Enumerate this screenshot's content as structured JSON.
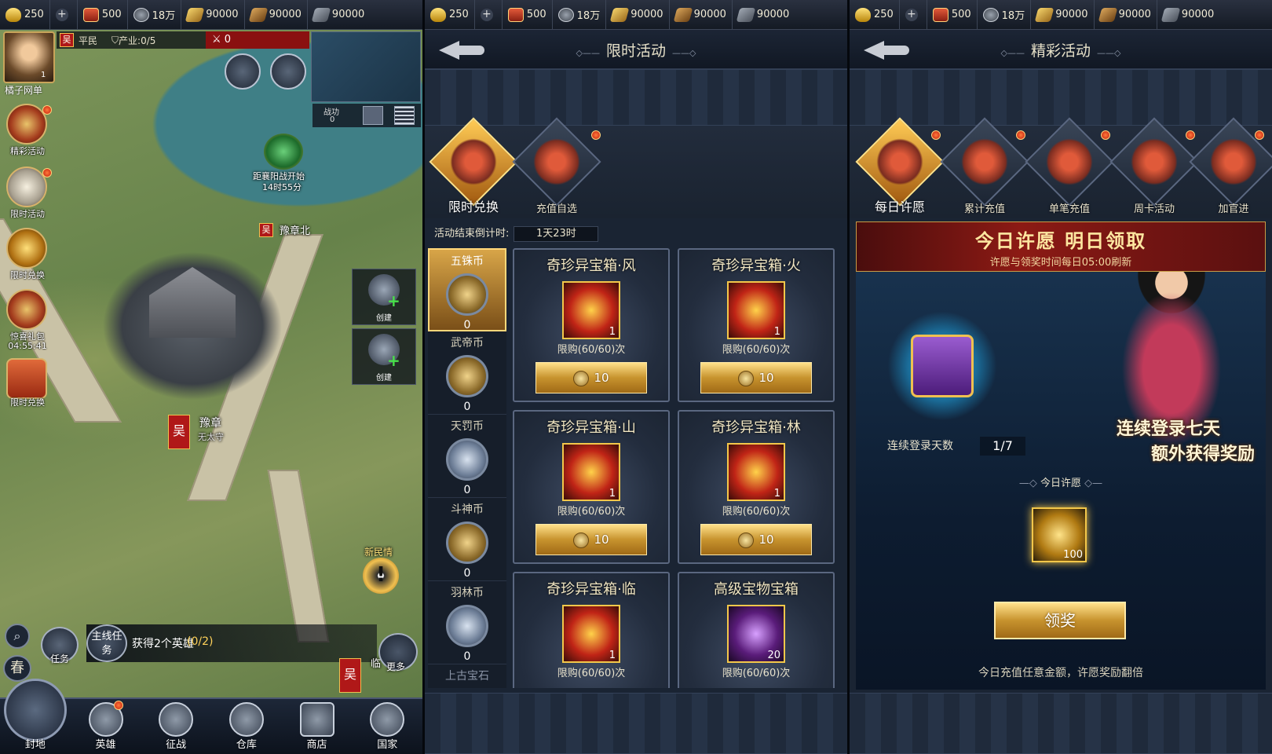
{
  "resources": {
    "gold": "250",
    "token": "500",
    "silver": "18万",
    "grain": "90000",
    "wood": "90000",
    "iron": "90000"
  },
  "map_panel": {
    "player_name": "橘子网单",
    "player_level": "1",
    "faction": "吴",
    "rank": "平民",
    "industry": "产业:0/5",
    "warn_count": "0",
    "side_buttons": [
      {
        "label": "精彩活动"
      },
      {
        "label": "限时活动"
      },
      {
        "label": "限时兑换"
      },
      {
        "label": "惊喜礼包",
        "timer": "04:55:41"
      },
      {
        "label": "限时兑换"
      }
    ],
    "battle_merit_label": "战功",
    "battle_merit_value": "0",
    "create_label": "创建",
    "event_label": "距襄阳战开始",
    "event_timer": "14时55分",
    "city_north": "豫章北",
    "city_main": "豫章",
    "city_main_owner": "无太守",
    "city_other": "临",
    "new_event": "新民情",
    "season": "春",
    "quest_btn": "主线任务",
    "quest_text": "获得2个英雄",
    "quest_progress": "(0/2)",
    "task_label": "任务",
    "more_label": "更多",
    "nav": [
      "封地",
      "英雄",
      "征战",
      "仓库",
      "商店",
      "国家"
    ]
  },
  "limited_panel": {
    "title": "限时活动",
    "tabs": [
      "限时兑换",
      "充值自选"
    ],
    "countdown_label": "活动结束倒计时:",
    "countdown_value": "1天23时",
    "coins": [
      {
        "name": "五铢币",
        "value": "0"
      },
      {
        "name": "武帝币",
        "value": "0"
      },
      {
        "name": "天罚币",
        "value": "0"
      },
      {
        "name": "斗神币",
        "value": "0"
      },
      {
        "name": "羽林币",
        "value": "0"
      },
      {
        "name": "上古宝石"
      }
    ],
    "cards": [
      {
        "name": "奇珍异宝箱·风",
        "count": "1",
        "limit": "限购(60/60)次",
        "price": "10"
      },
      {
        "name": "奇珍异宝箱·火",
        "count": "1",
        "limit": "限购(60/60)次",
        "price": "10"
      },
      {
        "name": "奇珍异宝箱·山",
        "count": "1",
        "limit": "限购(60/60)次",
        "price": "10"
      },
      {
        "name": "奇珍异宝箱·林",
        "count": "1",
        "limit": "限购(60/60)次",
        "price": "10"
      },
      {
        "name": "奇珍异宝箱·临",
        "count": "1",
        "limit": "限购(60/60)次"
      },
      {
        "name": "高级宝物宝箱",
        "count": "20",
        "limit": "限购(60/60)次"
      }
    ]
  },
  "wonderful_panel": {
    "title": "精彩活动",
    "tabs": [
      "每日许愿",
      "累计充值",
      "单笔充值",
      "周卡活动",
      "加官进"
    ],
    "banner_title": "今日许愿  明日领取",
    "banner_sub": "许愿与领奖时间每日05:00刷新",
    "slogan1": "连续登录七天",
    "slogan2": "额外获得奖励",
    "streak_label": "连续登录天数",
    "streak_value": "1/7",
    "today_wish": "今日许愿",
    "reward_count": "100",
    "claim_label": "领奖",
    "footnote": "今日充值任意金额，许愿奖励翻倍"
  }
}
